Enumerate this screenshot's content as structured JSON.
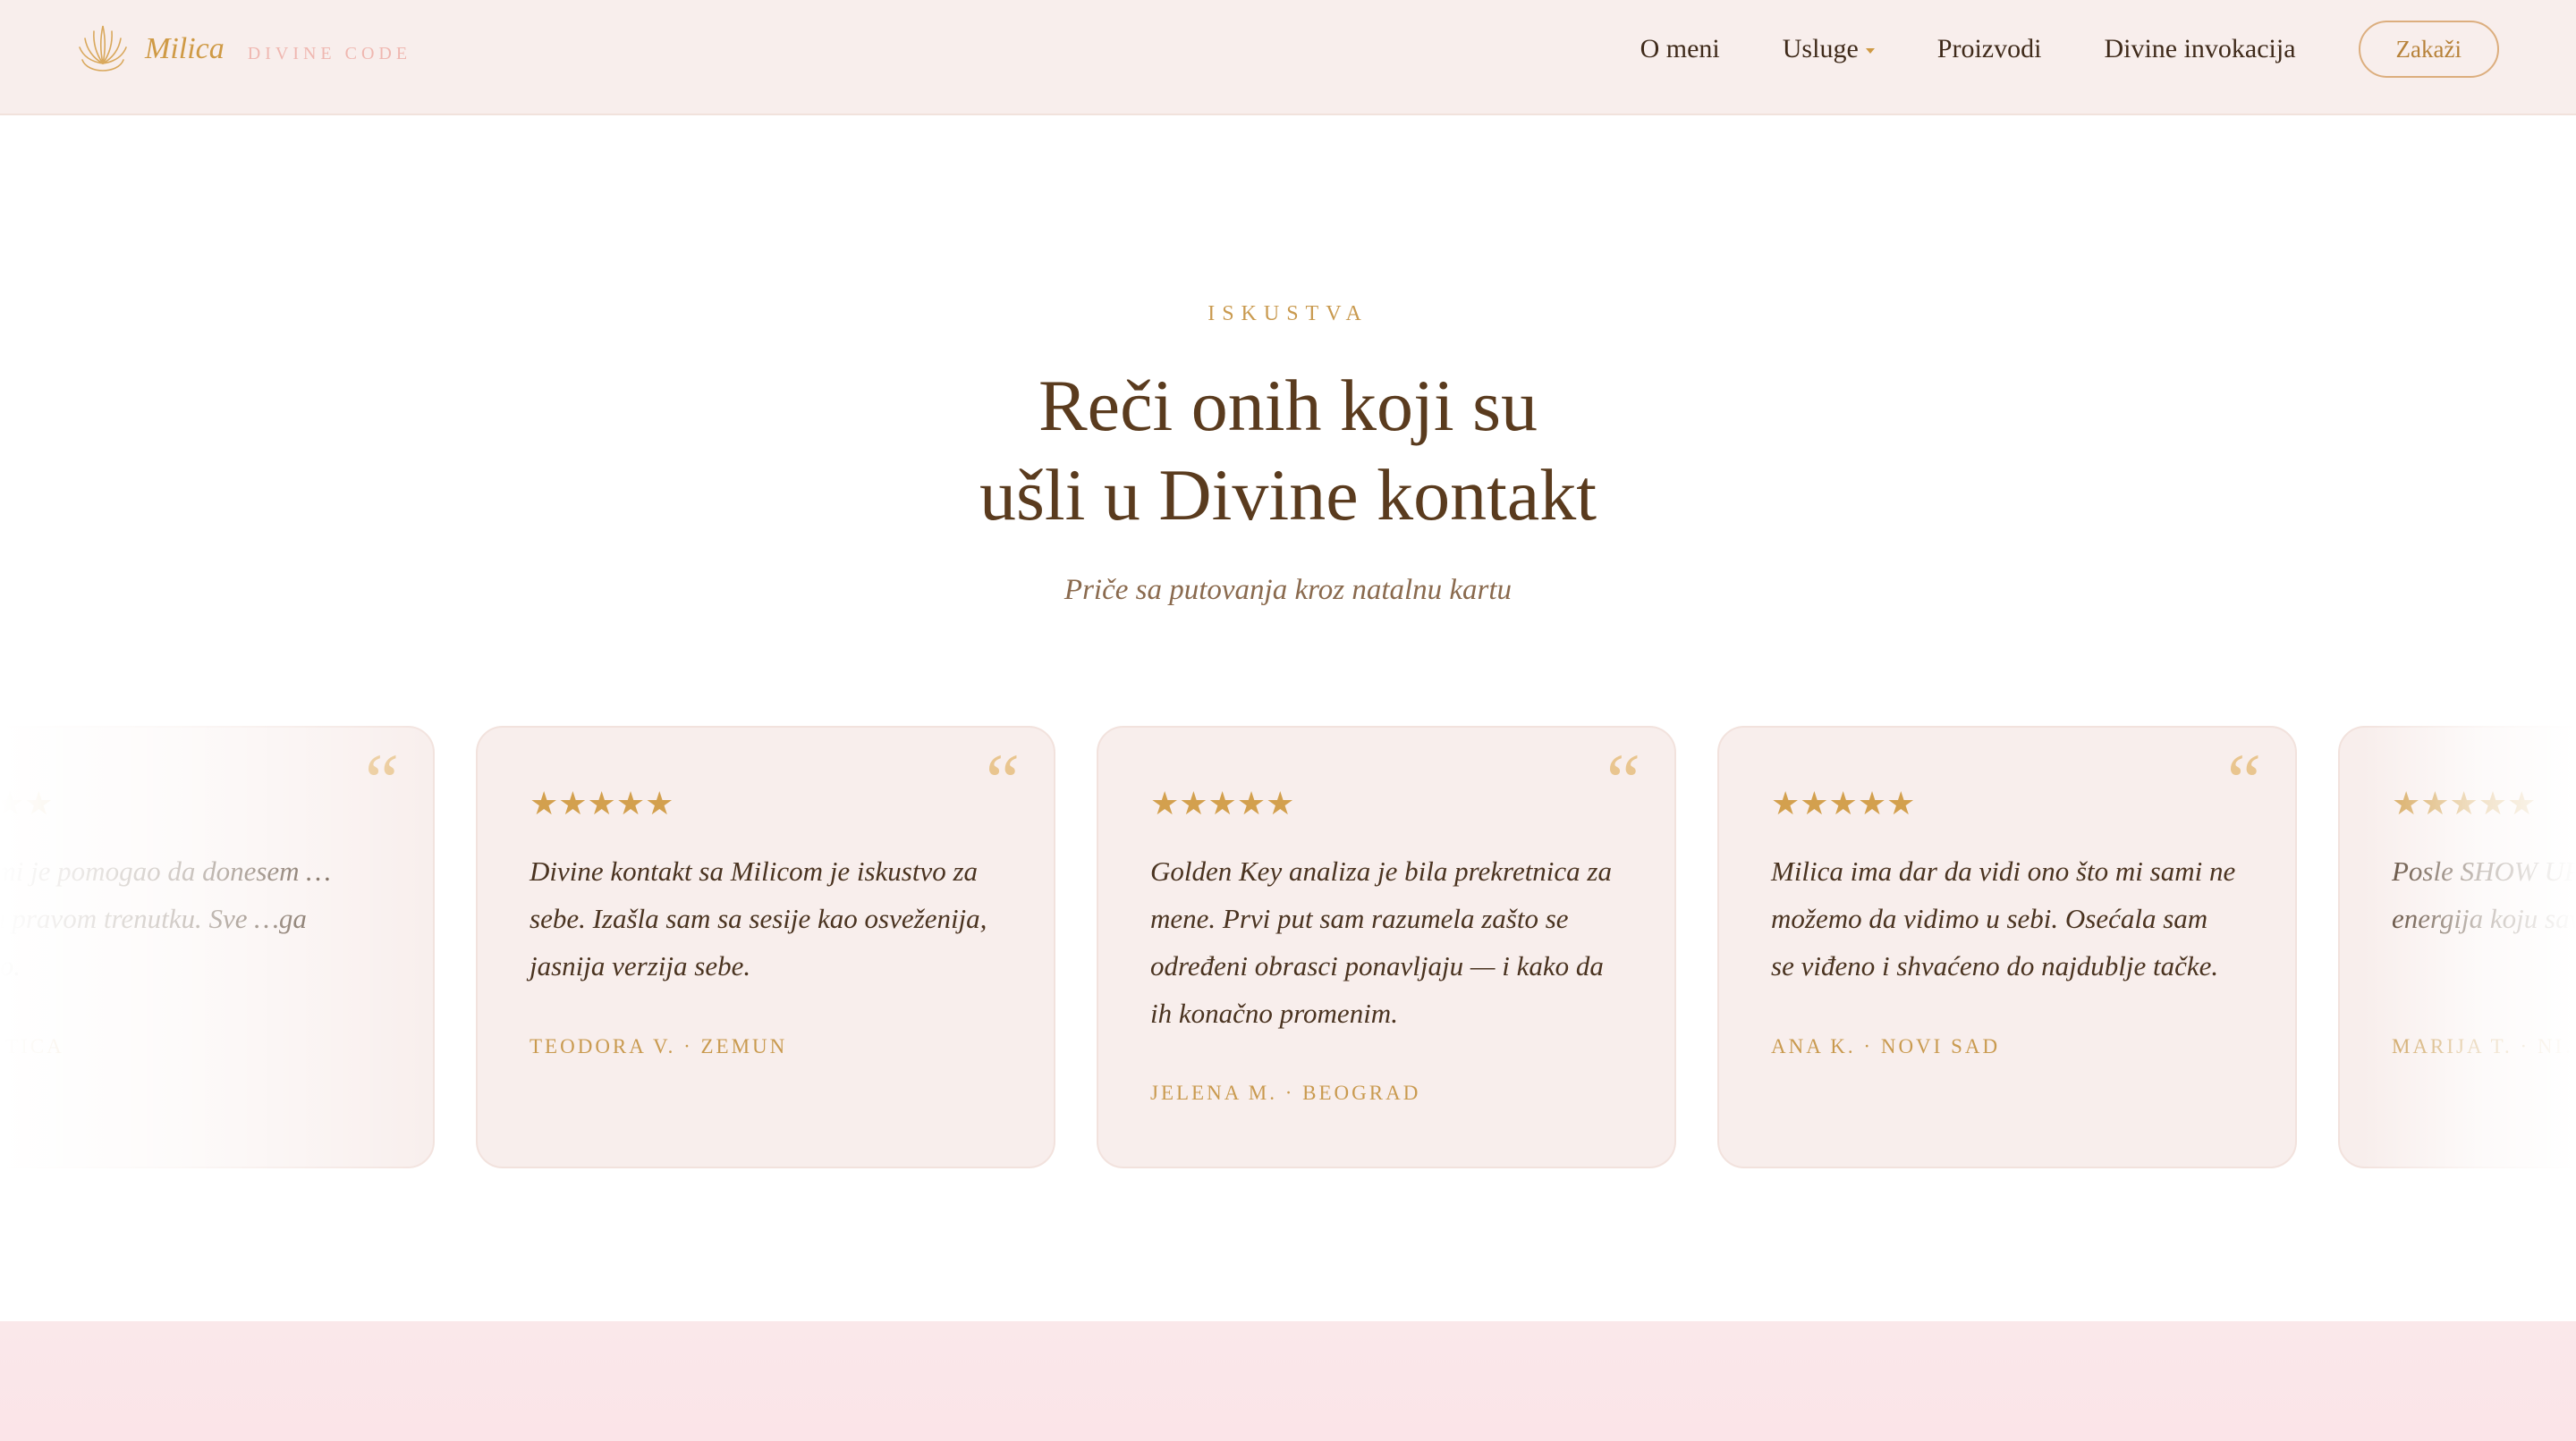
{
  "nav": {
    "brand_name": "Milica",
    "brand_sub": "DIVINE CODE",
    "links": [
      "O meni",
      "Usluge",
      "Proizvodi",
      "Divine invokacija"
    ],
    "cta": "Zakaži"
  },
  "section": {
    "eyebrow": "ISKUSTVA",
    "title_line1": "Reči onih koji su",
    "title_line2": "ušli u Divine kontakt",
    "subtitle": "Priče sa putovanja kroz natalnu kartu"
  },
  "testimonials": [
    {
      "stars": "★★★★★",
      "quote_mark": "“",
      "text": "…ming mi je pomogao da donesem … odluku u pravom trenutku. Sve …ga poklopilo.",
      "author": "… SUBOTICA"
    },
    {
      "stars": "★★★★★",
      "quote_mark": "“",
      "text": "Divine kontakt sa Milicom je iskustvo za sebe. Izašla sam sa sesije kao osveženija, jasnija verzija sebe.",
      "author": "TEODORA V. · ZEMUN"
    },
    {
      "stars": "★★★★★",
      "quote_mark": "“",
      "text": "Golden Key analiza je bila prekretnica za mene. Prvi put sam razumela zašto se određeni obrasci ponavljaju — i kako da ih konačno promenim.",
      "author": "JELENA M. · BEOGRAD"
    },
    {
      "stars": "★★★★★",
      "quote_mark": "“",
      "text": "Milica ima dar da vidi ono što mi sami ne možemo da vidimo u sebi. Osećala sam se viđeno i shvaćeno do najdublje tačke.",
      "author": "ANA K. · NOVI SAD"
    },
    {
      "stars": "★★★★★",
      "quote_mark": "“",
      "text": "Posle SHOW UP… počela da se poja… energija koju sav…",
      "author": "MARIJA T. · NI…"
    }
  ],
  "colors": {
    "gold": "#cf9a45",
    "brown": "#5a3b1e",
    "nav_bg": "#f8eeec",
    "card_bg": "#f8eeec",
    "pink": "#efb7b0"
  }
}
